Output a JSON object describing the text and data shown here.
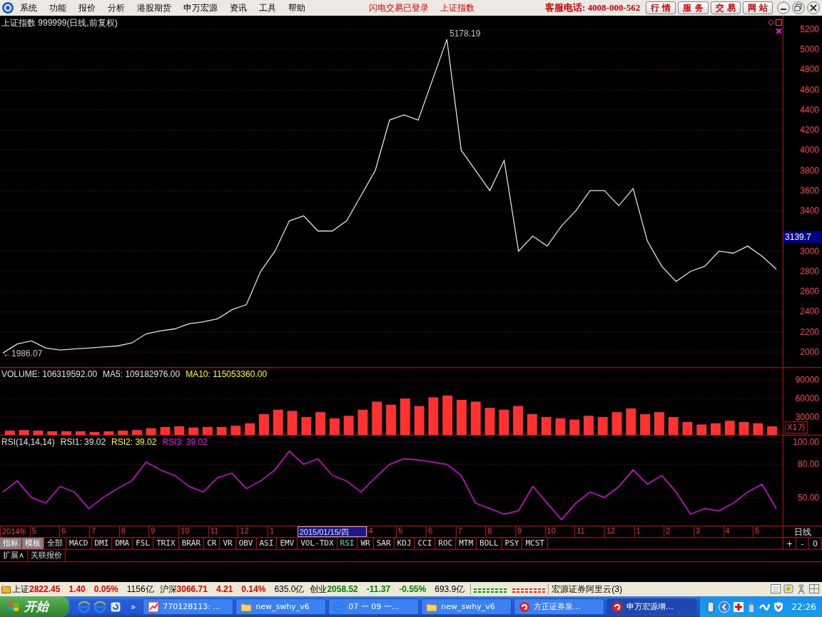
{
  "menu_bar": {
    "items": [
      "系统",
      "功能",
      "报价",
      "分析",
      "港股期货",
      "申万宏源",
      "资讯",
      "工具",
      "帮助"
    ],
    "notices": [
      "闪电交易已登录",
      "上证指数"
    ],
    "hotline": "客服电话: 4008-000-562",
    "buttons": [
      "行 情",
      "服 务",
      "交 易",
      "网 站"
    ]
  },
  "price_panel": {
    "title": "上证指数 999999(日线,前复权)",
    "high_label": "5178.19",
    "low_label": "←1986.07",
    "current_price": "3139.7",
    "chart_data": {
      "type": "line",
      "grid": true,
      "ylim": [
        1844,
        5334
      ],
      "yticks": [
        2000,
        2200,
        2400,
        2600,
        2800,
        3000,
        3400,
        3600,
        3800,
        4000,
        4200,
        4400,
        4600,
        4800,
        5000,
        5200
      ],
      "values": [
        1990,
        2080,
        2110,
        2040,
        2020,
        2030,
        2040,
        2050,
        2060,
        2090,
        2180,
        2210,
        2230,
        2280,
        2300,
        2330,
        2420,
        2470,
        2800,
        3000,
        3300,
        3350,
        3200,
        3200,
        3300,
        3550,
        3800,
        4300,
        4350,
        4300,
        4700,
        5100,
        4000,
        3800,
        3600,
        3900,
        3000,
        3150,
        3050,
        3250,
        3400,
        3600,
        3600,
        3450,
        3620,
        3100,
        2850,
        2700,
        2800,
        2850,
        3000,
        2980,
        3050,
        2950,
        2820
      ]
    }
  },
  "volume_panel": {
    "readouts": [
      {
        "text": "VOLUME: 106319592.00",
        "color": "#e0e0e0"
      },
      {
        "text": "MA5: 109182976.00",
        "color": "#e0e0e0"
      },
      {
        "text": "MA10: 115053360.00",
        "color": "#ffff00"
      }
    ],
    "unit": "X1万",
    "chart_data": {
      "type": "bar",
      "grid": true,
      "ylim": [
        0,
        110000
      ],
      "yticks": [
        30000,
        60000,
        90000
      ],
      "values": [
        8000,
        9000,
        8000,
        7000,
        7000,
        7000,
        6000,
        7000,
        8000,
        9000,
        12000,
        14000,
        15000,
        13000,
        14000,
        14000,
        16000,
        20000,
        35000,
        42000,
        40000,
        30000,
        38000,
        28000,
        32000,
        42000,
        55000,
        50000,
        60000,
        48000,
        62000,
        65000,
        58000,
        55000,
        45000,
        42000,
        48000,
        35000,
        30000,
        28000,
        26000,
        32000,
        30000,
        38000,
        44000,
        35000,
        38000,
        30000,
        22000,
        18000,
        20000,
        24000,
        22000,
        20000,
        15000
      ]
    }
  },
  "rsi_panel": {
    "readouts": [
      {
        "text": "RSI(14,14,14)",
        "color": "#e0e0e0"
      },
      {
        "text": "RSI1: 39.02",
        "color": "#e0e0e0"
      },
      {
        "text": "RSI2: 39.02",
        "color": "#ffff00"
      },
      {
        "text": "RSI3: 39.02",
        "color": "#ff00ff"
      }
    ],
    "chart_data": {
      "type": "line",
      "grid": true,
      "ylim": [
        24,
        106
      ],
      "yticks": [
        {
          "value": 50,
          "label": "50.00"
        },
        {
          "value": 80,
          "label": "80.00"
        },
        {
          "value": 100,
          "label": "100.00"
        }
      ],
      "values": [
        55,
        65,
        50,
        45,
        60,
        55,
        40,
        50,
        58,
        65,
        82,
        75,
        70,
        60,
        55,
        68,
        72,
        58,
        65,
        75,
        92,
        80,
        85,
        70,
        65,
        55,
        68,
        80,
        85,
        84,
        82,
        80,
        70,
        45,
        40,
        35,
        38,
        60,
        45,
        30,
        45,
        55,
        50,
        60,
        75,
        62,
        70,
        55,
        35,
        40,
        38,
        45,
        55,
        62,
        40
      ]
    }
  },
  "date_axis": {
    "labels": [
      {
        "text": "2014年",
        "selected": false
      },
      {
        "text": "5",
        "selected": false
      },
      {
        "text": "6",
        "selected": false
      },
      {
        "text": "7",
        "selected": false
      },
      {
        "text": "8",
        "selected": false
      },
      {
        "text": "9",
        "selected": false
      },
      {
        "text": "10",
        "selected": false
      },
      {
        "text": "11",
        "selected": false
      },
      {
        "text": "12",
        "selected": false
      },
      {
        "text": "1",
        "selected": false
      },
      {
        "text": "2015/01/15/四",
        "selected": true
      },
      {
        "text": "4",
        "selected": false
      },
      {
        "text": "5",
        "selected": false
      },
      {
        "text": "6",
        "selected": false
      },
      {
        "text": "7",
        "selected": false
      },
      {
        "text": "8",
        "selected": false
      },
      {
        "text": "9",
        "selected": false
      },
      {
        "text": "10",
        "selected": false
      },
      {
        "text": "11",
        "selected": false
      },
      {
        "text": "12",
        "selected": false
      },
      {
        "text": "1",
        "selected": false
      },
      {
        "text": "2",
        "selected": false
      },
      {
        "text": "3",
        "selected": false
      },
      {
        "text": "4",
        "selected": false
      },
      {
        "text": "5",
        "selected": false
      }
    ],
    "period": "日线"
  },
  "indicator_tabs": [
    {
      "label": "指标",
      "kind": "group",
      "selected": false
    },
    {
      "label": "模板",
      "kind": "group",
      "selected": false
    },
    {
      "label": "全部",
      "kind": "indicator",
      "selected": false
    },
    {
      "label": "MACD",
      "kind": "indicator",
      "selected": false
    },
    {
      "label": "DMI",
      "kind": "indicator",
      "selected": false
    },
    {
      "label": "DMA",
      "kind": "indicator",
      "selected": false
    },
    {
      "label": "FSL",
      "kind": "indicator",
      "selected": false
    },
    {
      "label": "TRIX",
      "kind": "indicator",
      "selected": false
    },
    {
      "label": "BRAR",
      "kind": "indicator",
      "selected": false
    },
    {
      "label": "CR",
      "kind": "indicator",
      "selected": false
    },
    {
      "label": "VR",
      "kind": "indicator",
      "selected": false
    },
    {
      "label": "OBV",
      "kind": "indicator",
      "selected": false
    },
    {
      "label": "ASI",
      "kind": "indicator",
      "selected": false
    },
    {
      "label": "EMV",
      "kind": "indicator",
      "selected": false
    },
    {
      "label": "VOL-TDX",
      "kind": "indicator",
      "selected": false
    },
    {
      "label": "RSI",
      "kind": "indicator",
      "selected": true
    },
    {
      "label": "WR",
      "kind": "indicator",
      "selected": false
    },
    {
      "label": "SAR",
      "kind": "indicator",
      "selected": false
    },
    {
      "label": "KDJ",
      "kind": "indicator",
      "selected": false
    },
    {
      "label": "CCI",
      "kind": "indicator",
      "selected": false
    },
    {
      "label": "ROC",
      "kind": "indicator",
      "selected": false
    },
    {
      "label": "MTM",
      "kind": "indicator",
      "selected": false
    },
    {
      "label": "BOLL",
      "kind": "indicator",
      "selected": false
    },
    {
      "label": "PSY",
      "kind": "indicator",
      "selected": false
    },
    {
      "label": "MCST",
      "kind": "indicator",
      "selected": false
    }
  ],
  "zoom_buttons": [
    "+",
    "-",
    "0"
  ],
  "extra_tabs": [
    "扩展∧",
    "关联报价"
  ],
  "status_bar": {
    "indices": [
      {
        "name": "上证",
        "value": "2822.45",
        "change": "1.40",
        "percent": "0.05%",
        "amount": "1156亿",
        "color": "#e00000"
      },
      {
        "name": "沪深",
        "value": "3066.71",
        "change": "4.21",
        "percent": "0.14%",
        "amount": "635.0亿",
        "color": "#e00000"
      },
      {
        "name": "创业",
        "value": "2058.52",
        "change": "-11.37",
        "percent": "-0.55%",
        "amount": "693.9亿",
        "color": "#008000"
      }
    ],
    "broker": "宏源证券阿里云(3)"
  },
  "taskbar": {
    "start": "开始",
    "more": "»",
    "tasks": [
      {
        "label": "770128113: ...",
        "kind": "chart",
        "selected": false
      },
      {
        "label": "new_swhy_v6",
        "kind": "folder",
        "selected": false
      },
      {
        "label": "07 一 09 一...",
        "kind": "browser",
        "selected": false
      },
      {
        "label": "new_swhy_v6",
        "kind": "folder",
        "selected": false
      },
      {
        "label": "方正证券泉...",
        "kind": "app",
        "selected": false
      },
      {
        "label": "申万宏源增...",
        "kind": "app",
        "selected": true
      }
    ],
    "clock": "22:26"
  }
}
